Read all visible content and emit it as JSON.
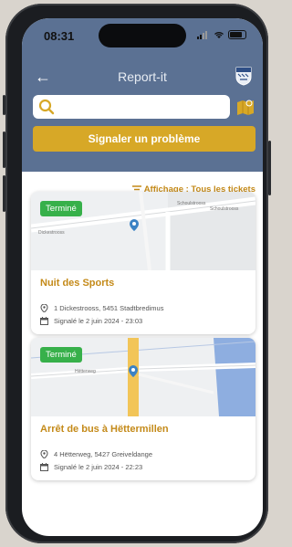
{
  "status_bar": {
    "time": "08:31"
  },
  "nav": {
    "back_icon": "arrow-left-icon",
    "title": "Report-it",
    "crest_icon": "municipality-crest-icon"
  },
  "search": {
    "value": "",
    "placeholder": "",
    "search_icon": "search-icon",
    "map_icon": "map-icon"
  },
  "actions": {
    "report_label": "Signaler un problème"
  },
  "filter": {
    "label": "Affichage : Tous les tickets",
    "icon": "filter-list-icon"
  },
  "colors": {
    "header": "#5b7193",
    "accent": "#d7a827",
    "accent_text": "#c48a19",
    "status_done": "#37b04a"
  },
  "tickets": [
    {
      "status": "Terminé",
      "title": "Nuit des Sports",
      "address": "1 Dickestrooss, 5451 Stadtbredimus",
      "date": "Signalé le 2 juin 2024 - 23:03",
      "map_labels": [
        "Dickestrooss",
        "Schoulstrooss",
        "Schoulstrooss"
      ]
    },
    {
      "status": "Terminé",
      "title": "Arrêt de bus à Hëttermillen",
      "address": "4 Hëtterweg, 5427 Greiveldange",
      "date": "Signalé le 2 juin 2024 - 22:23",
      "map_labels": [
        "Hëtterweg"
      ]
    }
  ]
}
